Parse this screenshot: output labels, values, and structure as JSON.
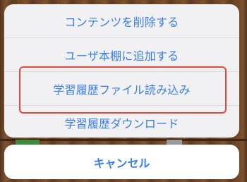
{
  "action_sheet": {
    "items": [
      {
        "label": "コンテンツを削除する"
      },
      {
        "label": "ユーザ本棚に追加する"
      },
      {
        "label": "学習履歴ファイル読み込み"
      },
      {
        "label": "学習履歴ダウンロード"
      }
    ],
    "cancel_label": "キャンセル",
    "highlighted_item": "学習履歴ファイル読み込み"
  },
  "colors": {
    "action_text": "#3a7ee4",
    "highlight_border": "#e2483d",
    "sheet_background": "#f1f1f3",
    "cancel_background": "#ffffff"
  }
}
